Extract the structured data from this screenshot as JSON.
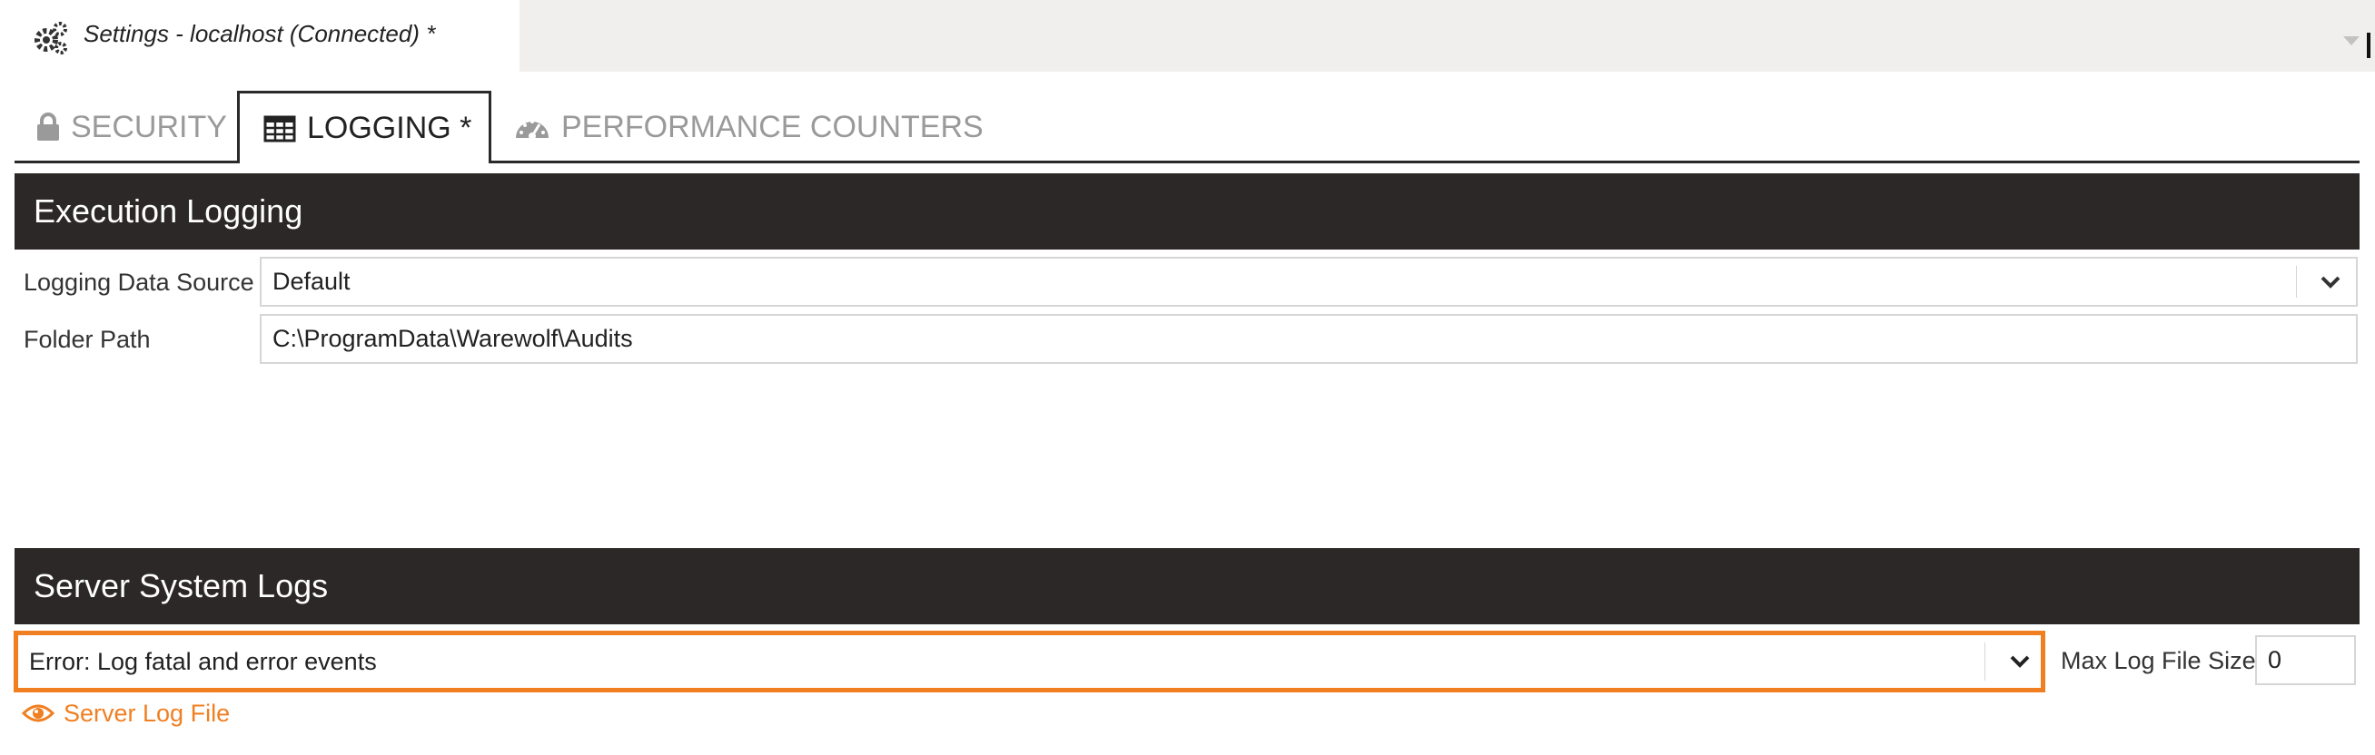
{
  "document_tab": {
    "icon": "gears-icon",
    "title": "Settings - localhost (Connected) *"
  },
  "tabs": [
    {
      "label": "SECURITY",
      "icon": "lock-icon",
      "active": false
    },
    {
      "label": "LOGGING *",
      "icon": "table-icon",
      "active": true
    },
    {
      "label": "PERFORMANCE COUNTERS",
      "icon": "gauge-icon",
      "active": false
    }
  ],
  "execution_logging": {
    "header": "Execution Logging",
    "data_source_label": "Logging Data Source",
    "data_source_value": "Default",
    "folder_path_label": "Folder Path",
    "folder_path_value": "C:\\ProgramData\\Warewolf\\Audits"
  },
  "server_system_logs": {
    "header": "Server System Logs",
    "log_level_value": "Error: Log fatal and error events",
    "max_log_size_label": "Max Log File Size",
    "max_log_size_value": "0",
    "server_log_link": "Server Log File",
    "server_log_link_icon": "eye-icon"
  },
  "colors": {
    "accent": "#f07f22",
    "header_bg": "#2b2827",
    "tab_inactive": "#9a9a9a"
  }
}
